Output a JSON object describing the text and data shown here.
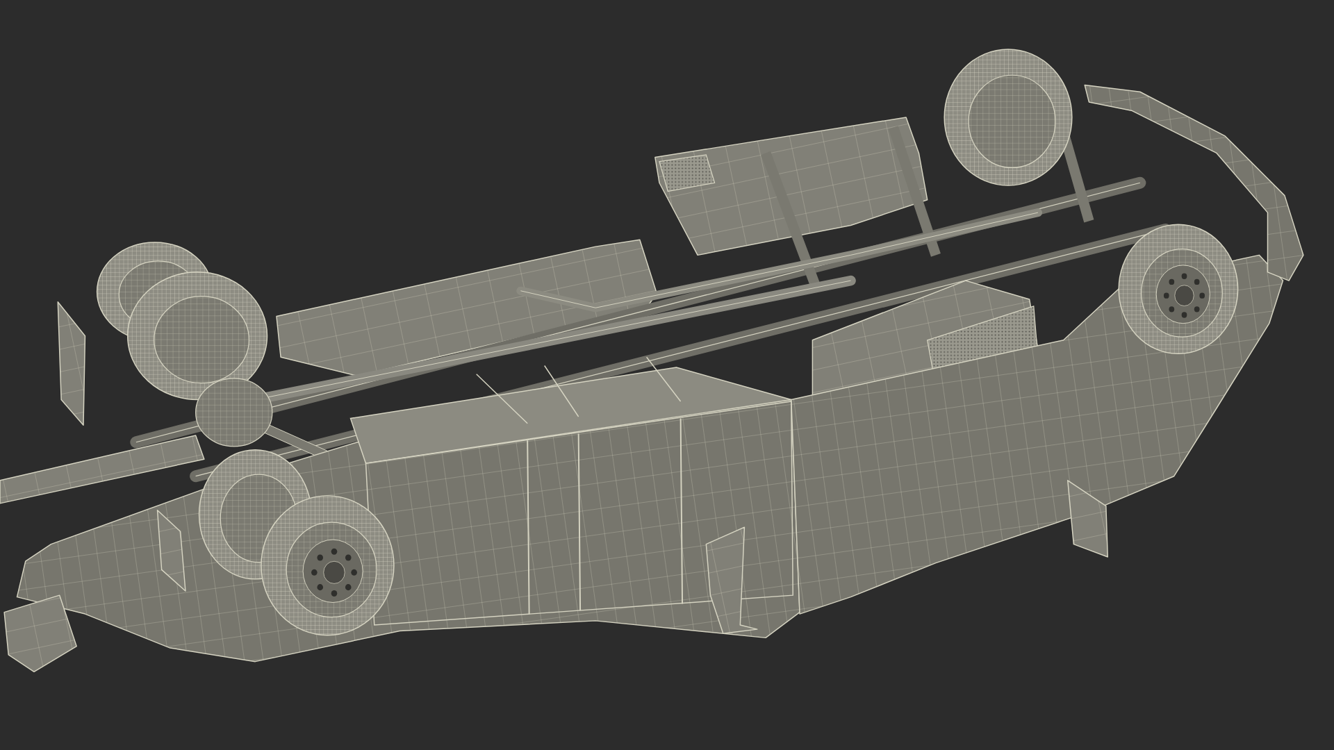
{
  "scene": {
    "kind": "wireframe-render"
  }
}
